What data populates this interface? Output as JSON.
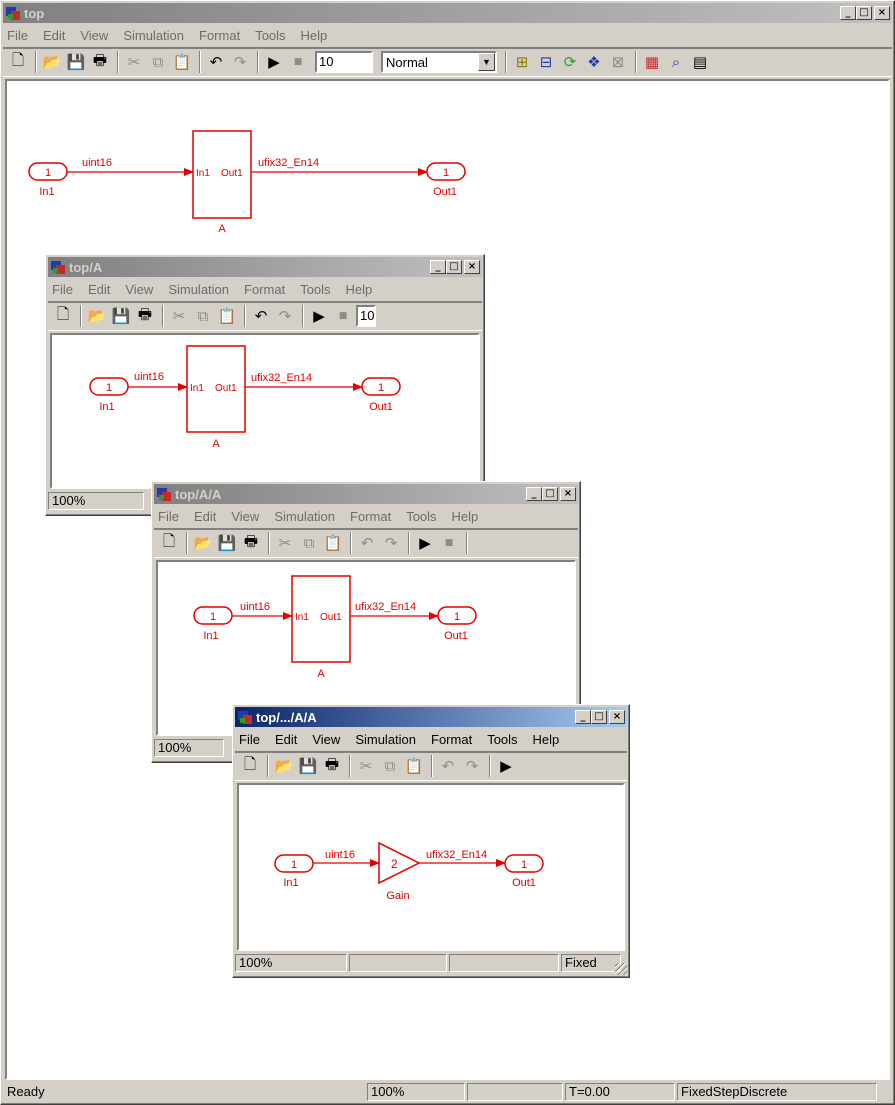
{
  "menu": [
    "File",
    "Edit",
    "View",
    "Simulation",
    "Format",
    "Tools",
    "Help"
  ],
  "colors": {
    "signal": "#e00000",
    "title_active": "#0a246a",
    "title_inactive": "#808080",
    "chrome": "#d4d0c8"
  },
  "icons": [
    "new-icon",
    "open-icon",
    "save-icon",
    "print-icon",
    "cut-icon",
    "copy-icon",
    "paste-icon",
    "undo-icon",
    "redo-icon",
    "play-icon",
    "stop-icon"
  ],
  "windows": {
    "top": {
      "title": "top",
      "stop_time": "10",
      "sim_mode": "Normal",
      "diagram": {
        "in_port": "1",
        "in_label": "In1",
        "in_sig": "uint16",
        "block_in": "In1",
        "block_out": "Out1",
        "block_name": "A",
        "out_sig": "ufix32_En14",
        "out_port": "1",
        "out_label": "Out1"
      },
      "status": {
        "ready": "Ready",
        "zoom": "100%",
        "time": "T=0.00",
        "solver": "FixedStepDiscrete"
      }
    },
    "top_a": {
      "title": "top/A",
      "stop_time": "10",
      "diagram": {
        "in_port": "1",
        "in_label": "In1",
        "in_sig": "uint16",
        "block_in": "In1",
        "block_out": "Out1",
        "block_name": "A",
        "out_sig": "ufix32_En14",
        "out_port": "1",
        "out_label": "Out1"
      },
      "status": {
        "zoom": "100%"
      }
    },
    "top_a_a": {
      "title": "top/A/A",
      "diagram": {
        "in_port": "1",
        "in_label": "In1",
        "in_sig": "uint16",
        "block_in": "In1",
        "block_out": "Out1",
        "block_name": "A",
        "out_sig": "ufix32_En14",
        "out_port": "1",
        "out_label": "Out1"
      },
      "status": {
        "zoom": "100%"
      }
    },
    "top_dots_a_a": {
      "title": "top/.../A/A",
      "diagram": {
        "in_port": "1",
        "in_label": "In1",
        "in_sig": "uint16",
        "gain_value": "2",
        "block_name": "Gain",
        "out_sig": "ufix32_En14",
        "out_port": "1",
        "out_label": "Out1"
      },
      "status": {
        "zoom": "100%",
        "mode": "Fixed"
      }
    }
  }
}
